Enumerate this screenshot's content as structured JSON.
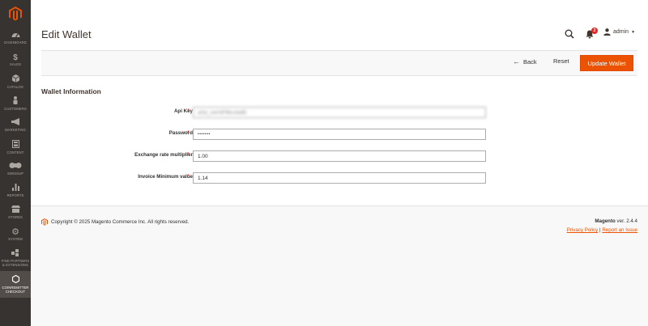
{
  "sidebar": {
    "items": [
      {
        "label": "DASHBOARD",
        "icon": "dashboard-icon"
      },
      {
        "label": "SALES",
        "icon": "dollar-icon"
      },
      {
        "label": "CATALOG",
        "icon": "cube-icon"
      },
      {
        "label": "CUSTOMERS",
        "icon": "person-icon"
      },
      {
        "label": "MARKETING",
        "icon": "megaphone-icon"
      },
      {
        "label": "CONTENT",
        "icon": "layout-icon"
      },
      {
        "label": "SWISSUP",
        "icon": "swissup-icon"
      },
      {
        "label": "REPORTS",
        "icon": "bar-chart-icon"
      },
      {
        "label": "STORES",
        "icon": "store-icon"
      },
      {
        "label": "SYSTEM",
        "icon": "gear-icon"
      },
      {
        "label_line1": "FIND PARTNERS",
        "label_line2": "& EXTENSIONS",
        "icon": "blocks-icon"
      },
      {
        "label_line1": "COINREMITTER",
        "label_line2": "CHECKOUT",
        "icon": "hexagon-icon"
      }
    ]
  },
  "header": {
    "title": "Edit Wallet",
    "notification_count": "2",
    "user": "admin"
  },
  "actions": {
    "back": "Back",
    "reset": "Reset",
    "update": "Update Wallet"
  },
  "form": {
    "section_title": "Wallet Information",
    "fields": [
      {
        "label": "Api Key",
        "value": "aSd_1eH3Ff8rc4a9E"
      },
      {
        "label": "Password",
        "value": "•••••••"
      },
      {
        "label": "Exchange rate multiplier",
        "value": "1.00"
      },
      {
        "label": "Invoice Minimum value",
        "value": "1.14"
      }
    ]
  },
  "footer": {
    "copyright": "Copyright © 2025 Magento Commerce Inc. All rights reserved.",
    "brand": "Magento",
    "version": "ver. 2.4.4",
    "privacy": "Privacy Policy",
    "separator": "|",
    "report": "Report an Issue"
  },
  "colors": {
    "sidebar_bg": "#373330",
    "accent": "#eb5202",
    "required": "#e22626"
  }
}
